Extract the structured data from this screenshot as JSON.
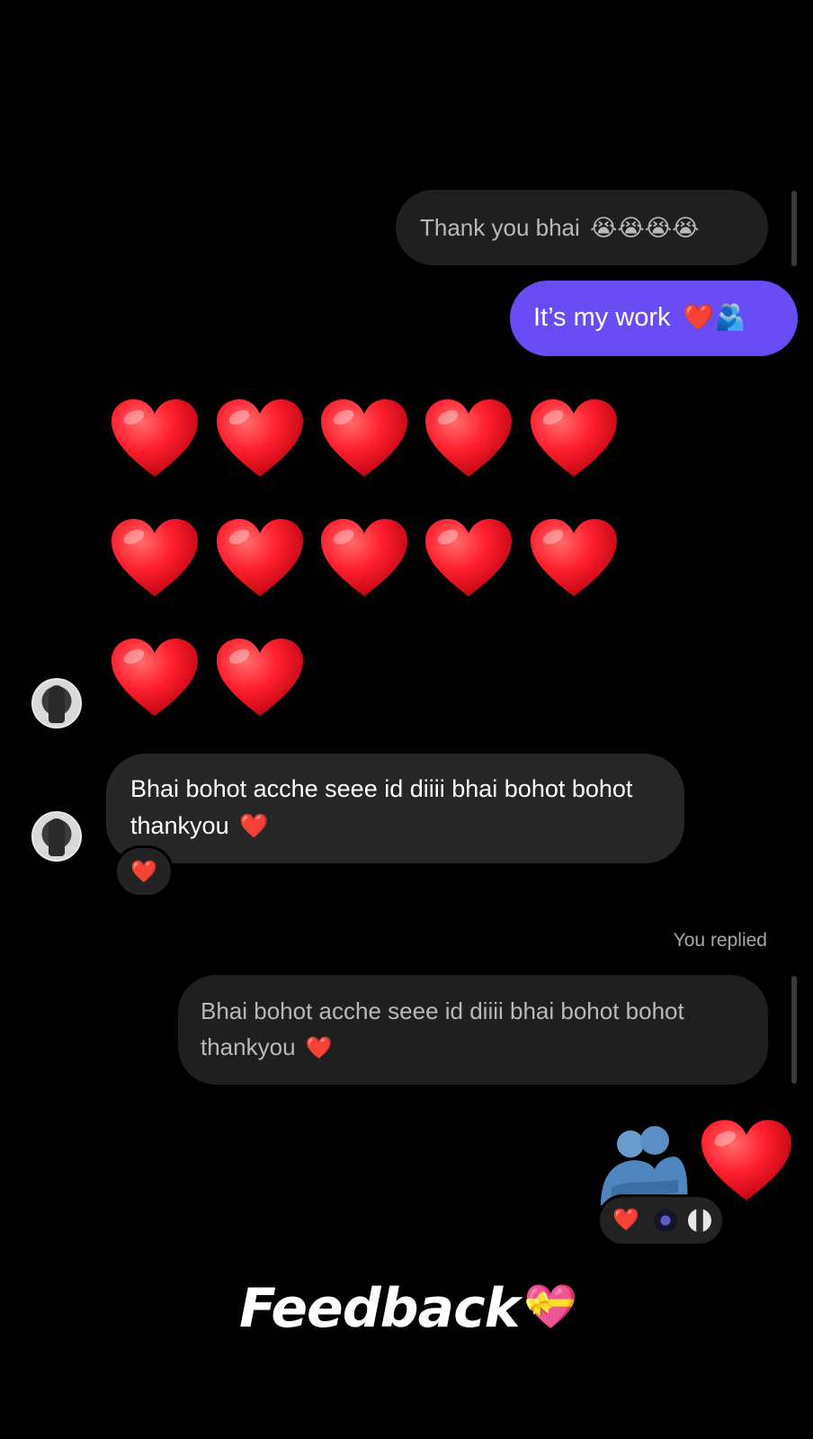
{
  "messages": {
    "quote_top": {
      "text": "Thank you bhai",
      "emoji": "😭😭😭😭"
    },
    "outgoing": {
      "text": "It’s my work",
      "emoji": "❤️🫂"
    },
    "heart_grid": {
      "rows": [
        5,
        5,
        2
      ],
      "emoji": "❤️"
    },
    "incoming": {
      "text": "Bhai bohot acche seee id diiii bhai bohot bohot thankyou",
      "emoji": "❤️",
      "reaction": "❤️"
    },
    "reply_label": "You replied",
    "quote_bottom": {
      "text": "Bhai bohot acche seee id diiii bhai bohot bohot thankyou",
      "emoji": "❤️"
    },
    "final": {
      "emoji_hug": "🫂",
      "emoji_heart": "❤️",
      "reactions": [
        "❤️",
        "avatar",
        "avatar"
      ]
    }
  },
  "caption": {
    "text": "Feedback",
    "emoji": "💝"
  },
  "colors": {
    "background": "#000000",
    "outgoing_bubble": "#6a4cf4",
    "incoming_bubble": "#262626",
    "quote_bubble": "#1f1f1f",
    "heart": "#ff1f2e"
  }
}
